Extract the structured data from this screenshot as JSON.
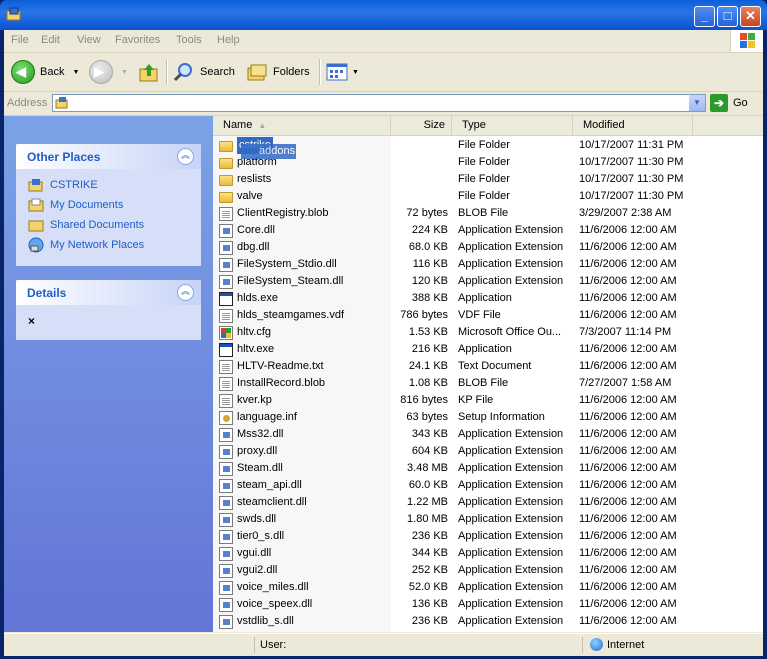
{
  "menu": [
    "File",
    "Edit",
    "View",
    "Favorites",
    "Tools",
    "Help"
  ],
  "toolbar": {
    "back_label": "Back",
    "search_label": "Search",
    "folders_label": "Folders"
  },
  "address": {
    "label": "Address",
    "value": "",
    "go_label": "Go"
  },
  "other_places": {
    "title": "Other Places",
    "items": [
      {
        "label": "CSTRIKE",
        "icon": "folder-up-icon"
      },
      {
        "label": "My Documents",
        "icon": "folder-icon"
      },
      {
        "label": "Shared Documents",
        "icon": "folder-icon"
      },
      {
        "label": "My Network Places",
        "icon": "network-icon"
      }
    ]
  },
  "details": {
    "title": "Details",
    "value": "×"
  },
  "columns": {
    "name": "Name",
    "size": "Size",
    "type": "Type",
    "modified": "Modified"
  },
  "drag_label": "addons",
  "files": [
    {
      "name": "cstrike",
      "size": "",
      "type": "File Folder",
      "modified": "10/17/2007 11:31 PM",
      "icon": "folder"
    },
    {
      "name": "platform",
      "size": "",
      "type": "File Folder",
      "modified": "10/17/2007 11:30 PM",
      "icon": "folder"
    },
    {
      "name": "reslists",
      "size": "",
      "type": "File Folder",
      "modified": "10/17/2007 11:30 PM",
      "icon": "folder"
    },
    {
      "name": "valve",
      "size": "",
      "type": "File Folder",
      "modified": "10/17/2007 11:30 PM",
      "icon": "folder"
    },
    {
      "name": "ClientRegistry.blob",
      "size": "72 bytes",
      "type": "BLOB File",
      "modified": "3/29/2007 2:38 AM",
      "icon": "file"
    },
    {
      "name": "Core.dll",
      "size": "224 KB",
      "type": "Application Extension",
      "modified": "11/6/2006 12:00 AM",
      "icon": "dll"
    },
    {
      "name": "dbg.dll",
      "size": "68.0 KB",
      "type": "Application Extension",
      "modified": "11/6/2006 12:00 AM",
      "icon": "dll"
    },
    {
      "name": "FileSystem_Stdio.dll",
      "size": "116 KB",
      "type": "Application Extension",
      "modified": "11/6/2006 12:00 AM",
      "icon": "dll"
    },
    {
      "name": "FileSystem_Steam.dll",
      "size": "120 KB",
      "type": "Application Extension",
      "modified": "11/6/2006 12:00 AM",
      "icon": "dll"
    },
    {
      "name": "hlds.exe",
      "size": "388 KB",
      "type": "Application",
      "modified": "11/6/2006 12:00 AM",
      "icon": "exe"
    },
    {
      "name": "hlds_steamgames.vdf",
      "size": "786 bytes",
      "type": "VDF File",
      "modified": "11/6/2006 12:00 AM",
      "icon": "file"
    },
    {
      "name": "hltv.cfg",
      "size": "1.53 KB",
      "type": "Microsoft Office Ou...",
      "modified": "7/3/2007 11:14 PM",
      "icon": "cfg"
    },
    {
      "name": "hltv.exe",
      "size": "216 KB",
      "type": "Application",
      "modified": "11/6/2006 12:00 AM",
      "icon": "exe"
    },
    {
      "name": "HLTV-Readme.txt",
      "size": "24.1 KB",
      "type": "Text Document",
      "modified": "11/6/2006 12:00 AM",
      "icon": "file"
    },
    {
      "name": "InstallRecord.blob",
      "size": "1.08 KB",
      "type": "BLOB File",
      "modified": "7/27/2007 1:58 AM",
      "icon": "file"
    },
    {
      "name": "kver.kp",
      "size": "816 bytes",
      "type": "KP File",
      "modified": "11/6/2006 12:00 AM",
      "icon": "file"
    },
    {
      "name": "language.inf",
      "size": "63 bytes",
      "type": "Setup Information",
      "modified": "11/6/2006 12:00 AM",
      "icon": "inf"
    },
    {
      "name": "Mss32.dll",
      "size": "343 KB",
      "type": "Application Extension",
      "modified": "11/6/2006 12:00 AM",
      "icon": "dll"
    },
    {
      "name": "proxy.dll",
      "size": "604 KB",
      "type": "Application Extension",
      "modified": "11/6/2006 12:00 AM",
      "icon": "dll"
    },
    {
      "name": "Steam.dll",
      "size": "3.48 MB",
      "type": "Application Extension",
      "modified": "11/6/2006 12:00 AM",
      "icon": "dll"
    },
    {
      "name": "steam_api.dll",
      "size": "60.0 KB",
      "type": "Application Extension",
      "modified": "11/6/2006 12:00 AM",
      "icon": "dll"
    },
    {
      "name": "steamclient.dll",
      "size": "1.22 MB",
      "type": "Application Extension",
      "modified": "11/6/2006 12:00 AM",
      "icon": "dll"
    },
    {
      "name": "swds.dll",
      "size": "1.80 MB",
      "type": "Application Extension",
      "modified": "11/6/2006 12:00 AM",
      "icon": "dll"
    },
    {
      "name": "tier0_s.dll",
      "size": "236 KB",
      "type": "Application Extension",
      "modified": "11/6/2006 12:00 AM",
      "icon": "dll"
    },
    {
      "name": "vgui.dll",
      "size": "344 KB",
      "type": "Application Extension",
      "modified": "11/6/2006 12:00 AM",
      "icon": "dll"
    },
    {
      "name": "vgui2.dll",
      "size": "252 KB",
      "type": "Application Extension",
      "modified": "11/6/2006 12:00 AM",
      "icon": "dll"
    },
    {
      "name": "voice_miles.dll",
      "size": "52.0 KB",
      "type": "Application Extension",
      "modified": "11/6/2006 12:00 AM",
      "icon": "dll"
    },
    {
      "name": "voice_speex.dll",
      "size": "136 KB",
      "type": "Application Extension",
      "modified": "11/6/2006 12:00 AM",
      "icon": "dll"
    },
    {
      "name": "vstdlib_s.dll",
      "size": "236 KB",
      "type": "Application Extension",
      "modified": "11/6/2006 12:00 AM",
      "icon": "dll"
    }
  ],
  "status": {
    "user": "User:",
    "zone": "Internet"
  }
}
